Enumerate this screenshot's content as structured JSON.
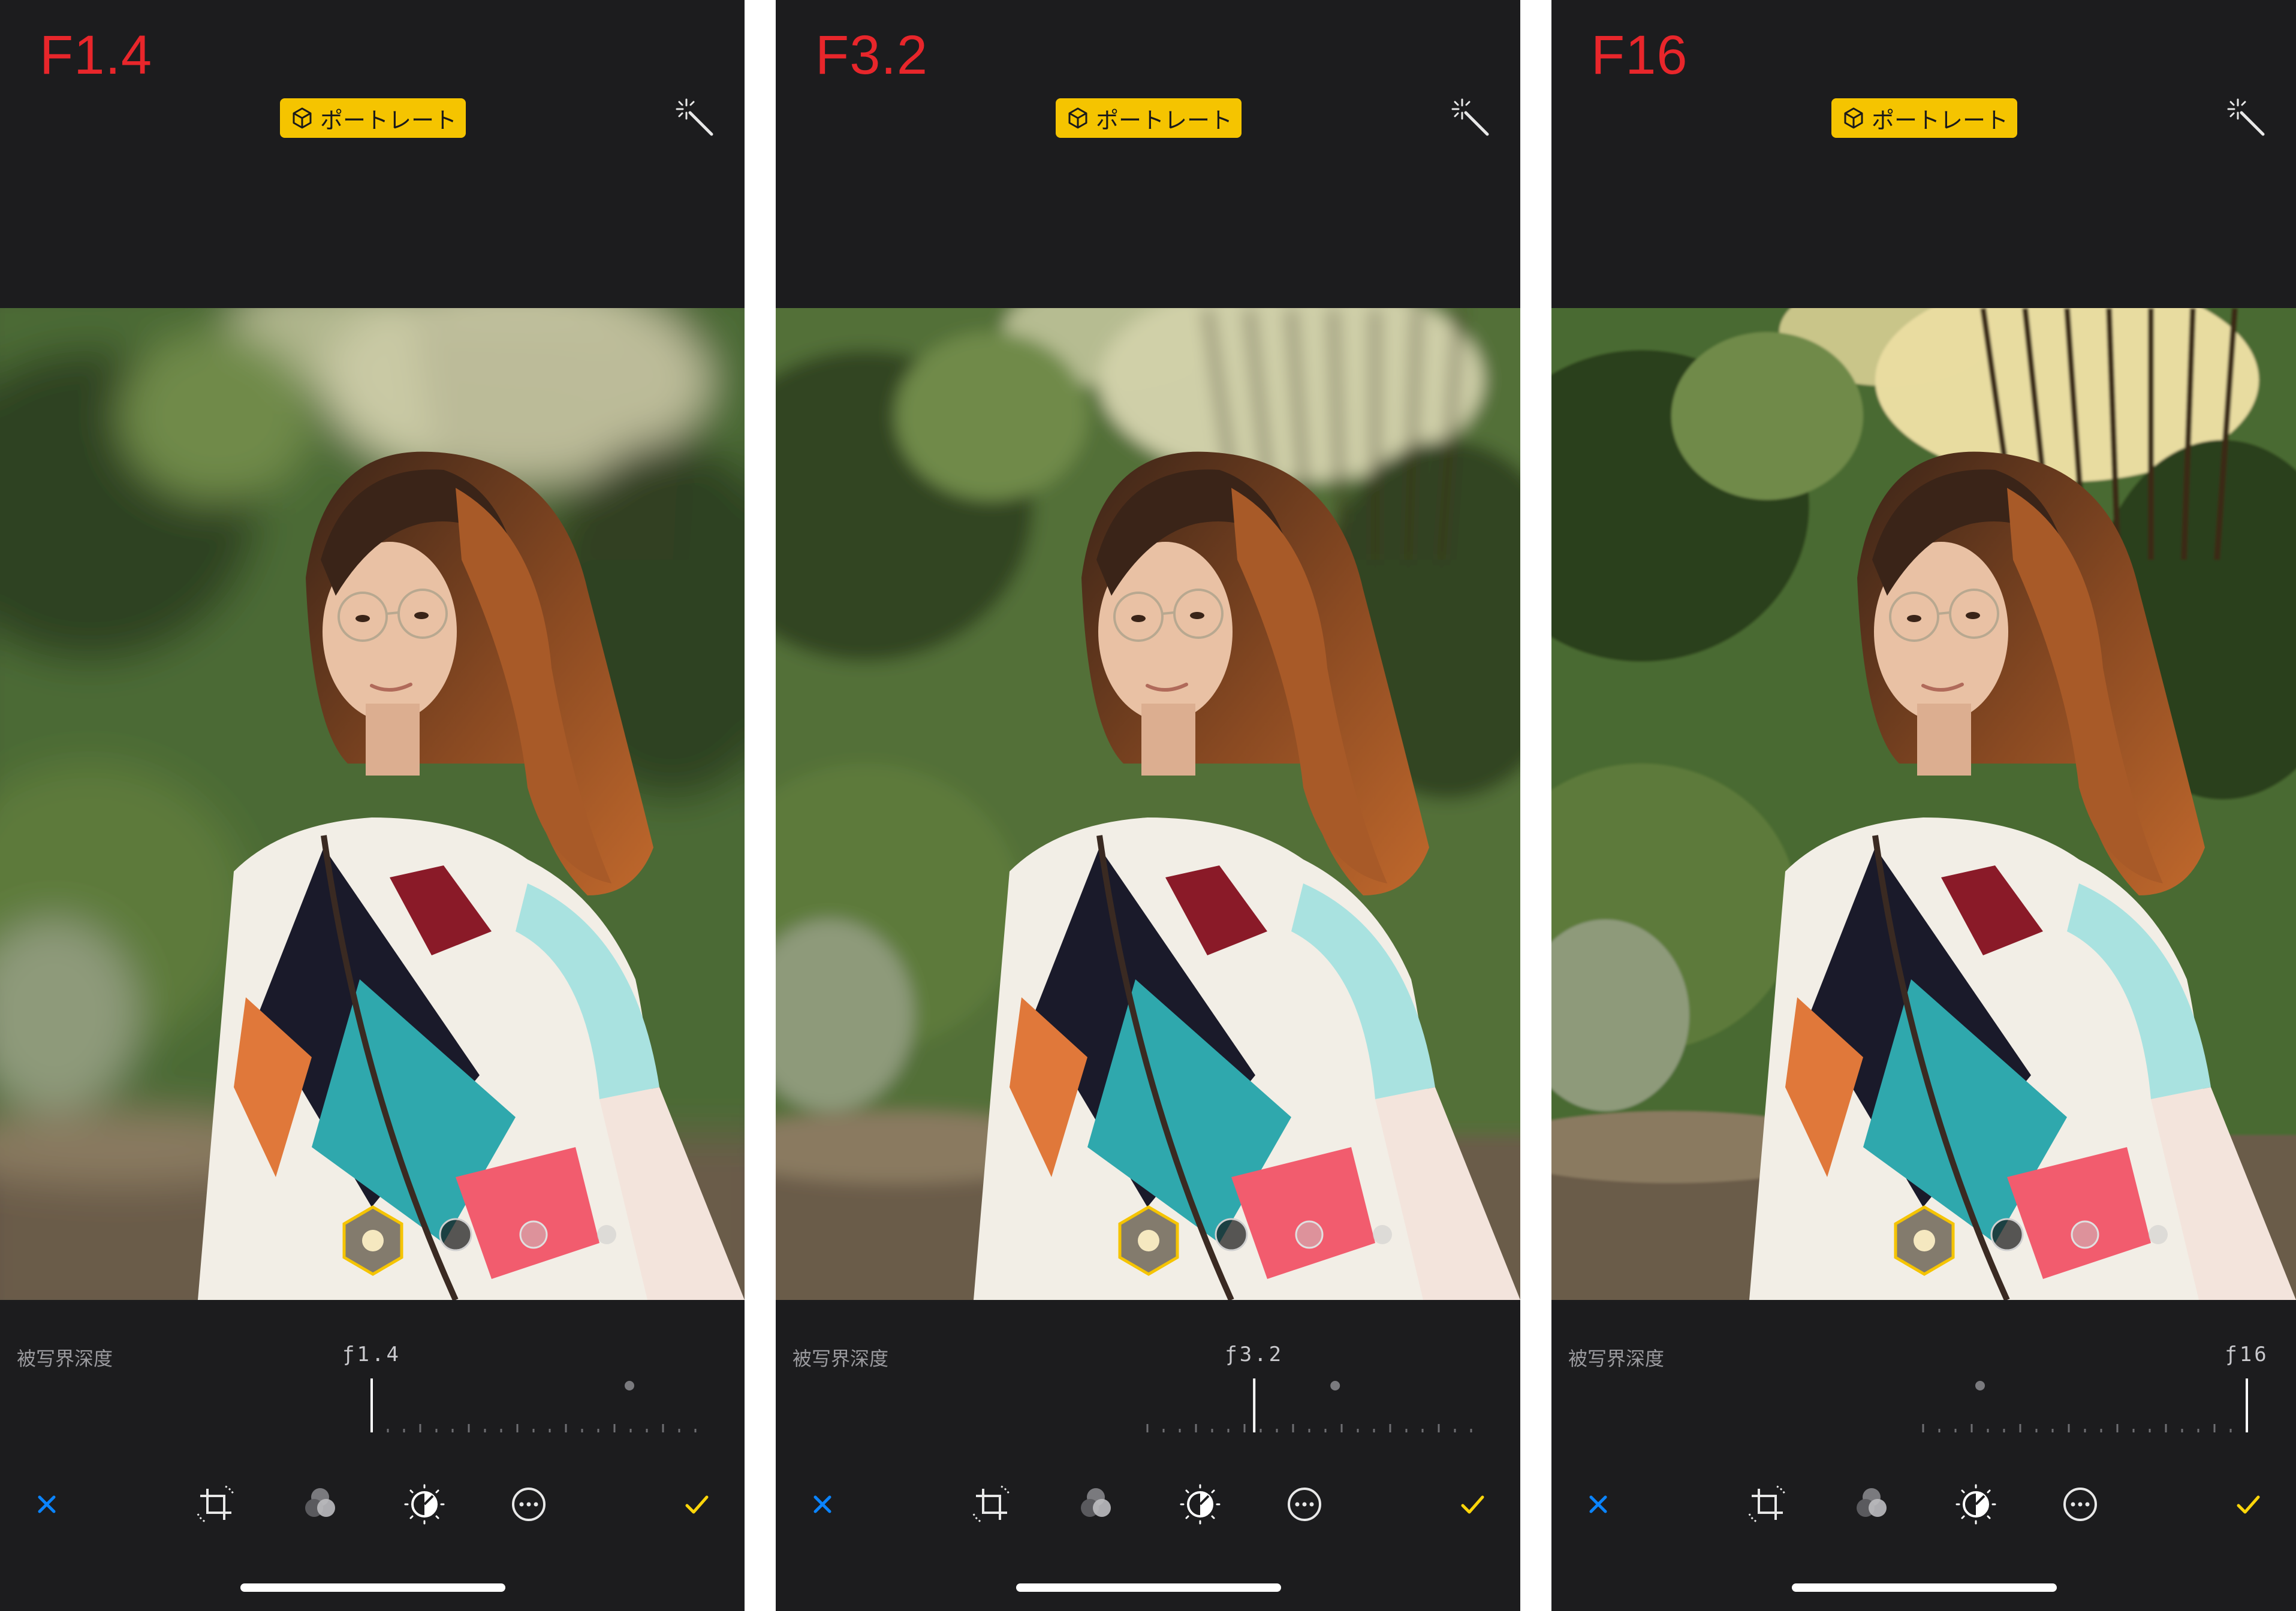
{
  "panels": [
    {
      "aperture_title": "F1.4",
      "mode_badge": "ポートレート",
      "depth_label": "被写界深度",
      "f_value": "ƒ1.4",
      "depth_slider_value": 0.0,
      "blur_amount": 34,
      "colors": {
        "bg_sky": "#c9c9a4",
        "foliage": "#4c6a36",
        "foliage_dark": "#2e4220"
      }
    },
    {
      "aperture_title": "F3.2",
      "mode_badge": "ポートレート",
      "depth_label": "被写界深度",
      "f_value": "ƒ3.2",
      "depth_slider_value": 0.33,
      "blur_amount": 14,
      "colors": {
        "bg_sky": "#cfcfa8",
        "foliage": "#536f38",
        "foliage_dark": "#304420"
      }
    },
    {
      "aperture_title": "F16",
      "mode_badge": "ポートレート",
      "depth_label": "被写界深度",
      "f_value": "ƒ16",
      "depth_slider_value": 1.0,
      "blur_amount": 2,
      "colors": {
        "bg_sky": "#e8dca0",
        "foliage": "#4a6a30",
        "foliage_dark": "#2a3f1a"
      }
    }
  ],
  "toolbar_icons": [
    "cancel-x-icon",
    "crop-rotate-icon",
    "filters-icon",
    "adjust-dial-icon",
    "more-options-icon",
    "done-check-icon"
  ],
  "accent_colors": {
    "cancel": "#0a84ff",
    "done": "#ffd60a",
    "badge": "#f5c400",
    "title": "#e8262b"
  }
}
